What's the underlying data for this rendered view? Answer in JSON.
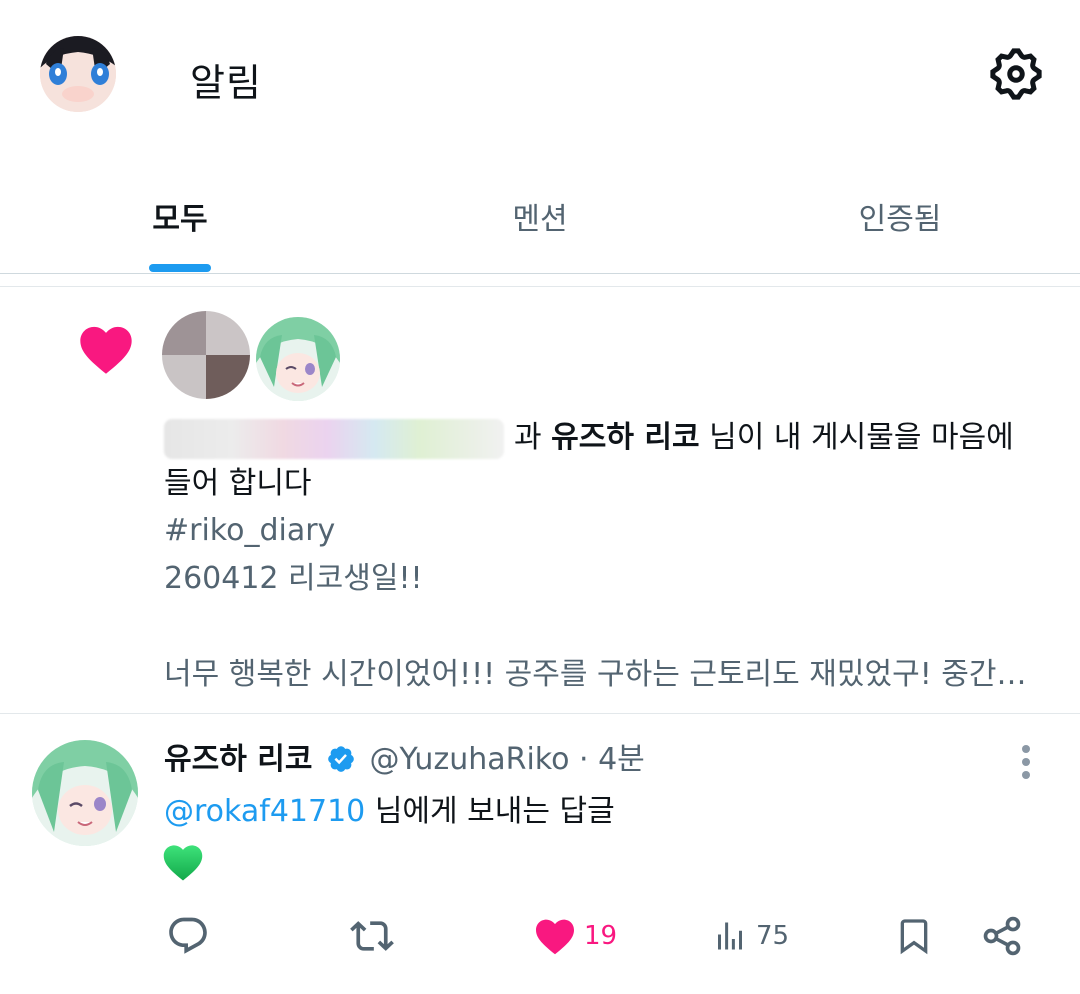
{
  "header": {
    "title": "알림"
  },
  "tabs": [
    {
      "label": "모두",
      "active": true
    },
    {
      "label": "멘션",
      "active": false
    },
    {
      "label": "인증됨",
      "active": false
    }
  ],
  "like_notification": {
    "connector": "과",
    "named_user": "유즈하 리코",
    "message_part1": "님이 내 게시물을 마음에",
    "message_part2": "들어 합니다",
    "post_lines": [
      "#riko_diary",
      "260412 리코생일!!",
      "",
      "너무 행복한 시간이었어!!! 공주를 구하는 근토리도 재밌었구! 중간에 …"
    ]
  },
  "reply": {
    "name": "유즈하 리코",
    "handle": "@YuzuhaRiko",
    "separator": "·",
    "time": "4분",
    "mention": "@rokaf41710",
    "reply_text": "님에게 보내는 답글",
    "like_count": "19",
    "view_count": "75"
  },
  "colors": {
    "accent": "#1d9bf0",
    "like": "#f91880",
    "muted": "#536471",
    "green_heart": "#1fc25a"
  },
  "icons": [
    "gear-icon",
    "heart-icon",
    "verified-badge-icon",
    "more-icon",
    "comment-icon",
    "retweet-icon",
    "views-icon",
    "bookmark-icon",
    "share-icon"
  ]
}
